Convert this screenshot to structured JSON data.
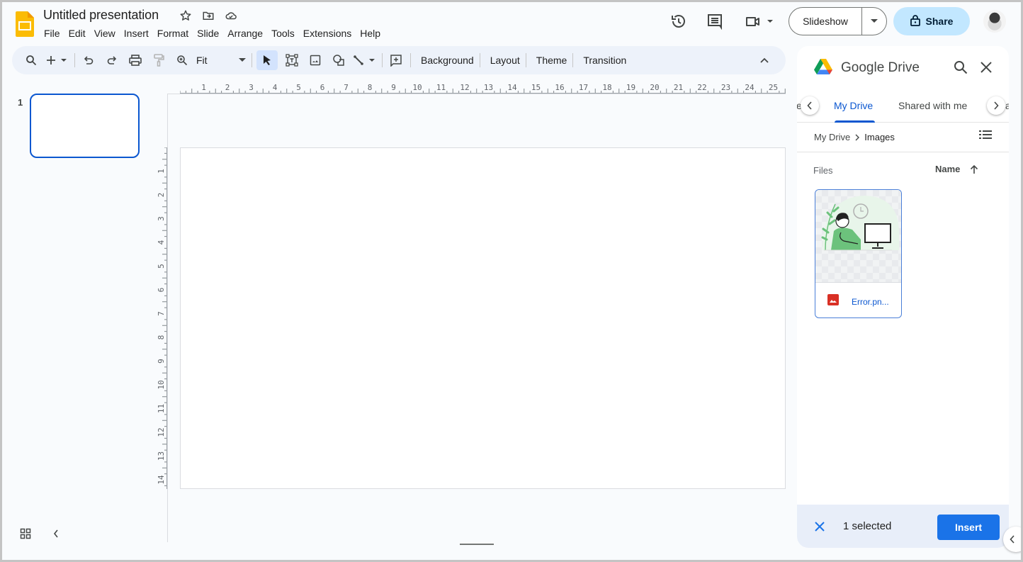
{
  "app": {
    "title": "Untitled presentation",
    "menu": [
      "File",
      "Edit",
      "View",
      "Insert",
      "Format",
      "Slide",
      "Arrange",
      "Tools",
      "Extensions",
      "Help"
    ],
    "brand_color": "#fbbc04",
    "accent_color": "#0b57d0"
  },
  "header": {
    "icons": [
      "star-icon",
      "move-to-folder-icon",
      "cloud-saved-icon",
      "version-history-icon",
      "comments-icon",
      "meet-icon"
    ],
    "slideshow_label": "Slideshow",
    "share_label": "Share",
    "share_color": "#c2e7ff"
  },
  "toolbar": {
    "zoom_value": "Fit",
    "buttons": [
      "Background",
      "Layout",
      "Theme",
      "Transition"
    ]
  },
  "filmstrip": {
    "slides": [
      {
        "number": "1"
      }
    ]
  },
  "rulers": {
    "horizontal": [
      "1",
      "2",
      "3",
      "4",
      "5",
      "6",
      "7",
      "8",
      "9",
      "10",
      "11",
      "12",
      "13",
      "14",
      "15",
      "16",
      "17",
      "18",
      "19",
      "20",
      "21",
      "22",
      "23",
      "24",
      "25"
    ],
    "vertical": [
      "1",
      "2",
      "3",
      "4",
      "5",
      "6",
      "7",
      "8",
      "9",
      "10",
      "11",
      "12",
      "13",
      "14"
    ]
  },
  "drive": {
    "title": "Google Drive",
    "tabs": [
      {
        "label": "My Drive",
        "active": true
      },
      {
        "label": "Shared with me",
        "active": false
      }
    ],
    "partial_left": "e",
    "partial_right": "a",
    "breadcrumb": [
      "My Drive",
      "Images"
    ],
    "files_label": "Files",
    "sort_label": "Name",
    "files": [
      {
        "name": "Error.pn...",
        "type": "image",
        "selected": true
      }
    ],
    "selected_text": "1 selected",
    "insert_label": "Insert"
  }
}
